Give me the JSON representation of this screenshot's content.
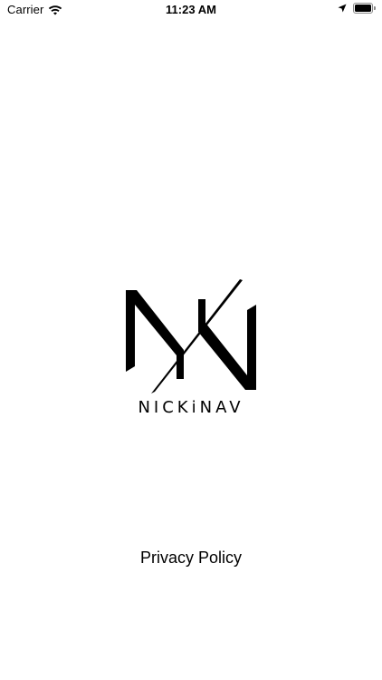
{
  "status_bar": {
    "carrier": "Carrier",
    "time": "11:23 AM",
    "battery_level": 1.0,
    "icons": [
      "wifi-icon",
      "location-arrow-icon",
      "battery-icon"
    ]
  },
  "splash": {
    "logo_icon": "nn-monogram-logo",
    "brand_name": "NICKiNAV",
    "privacy_link": "Privacy Policy"
  },
  "colors": {
    "background": "#ffffff",
    "foreground": "#000000"
  }
}
